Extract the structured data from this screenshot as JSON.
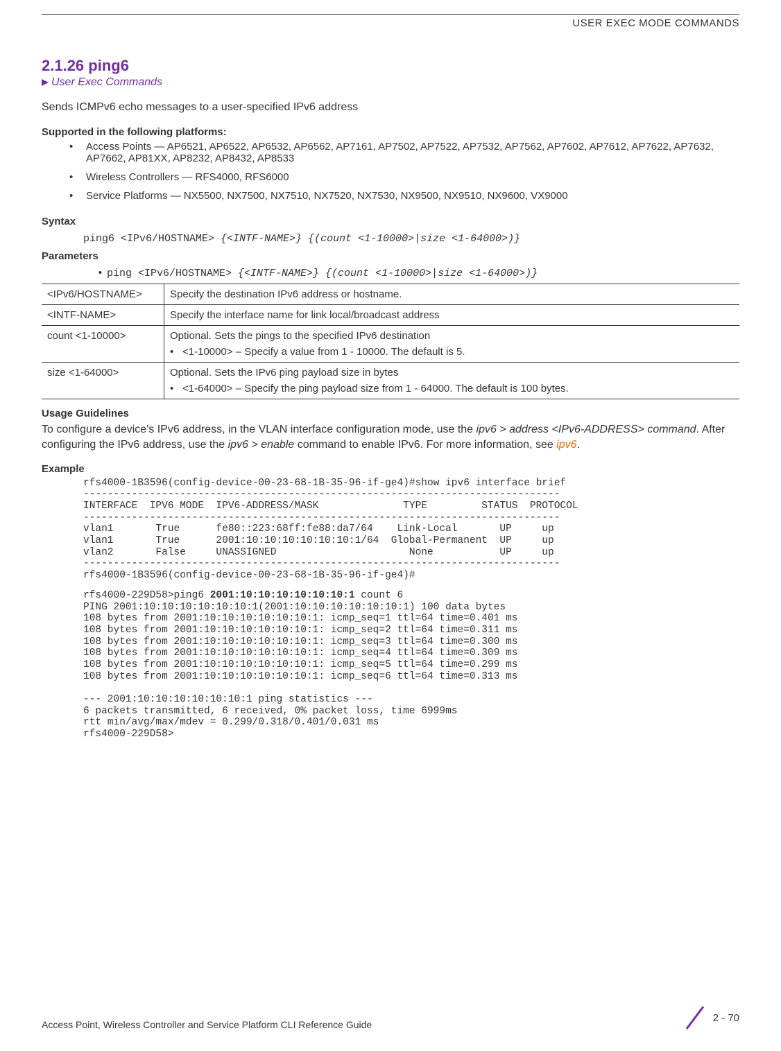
{
  "header": {
    "title": "USER EXEC MODE COMMANDS"
  },
  "section": {
    "number_title": "2.1.26 ping6",
    "breadcrumb": "User Exec Commands",
    "intro": "Sends ICMPv6 echo messages to a user-specified IPv6 address"
  },
  "supported": {
    "heading": "Supported in the following platforms:",
    "items": [
      "Access Points — AP6521, AP6522, AP6532, AP6562, AP7161, AP7502, AP7522, AP7532, AP7562, AP7602, AP7612, AP7622, AP7632, AP7662, AP81XX, AP8232, AP8432, AP8533",
      "Wireless Controllers — RFS4000, RFS6000",
      "Service Platforms — NX5500, NX7500, NX7510, NX7520, NX7530, NX9500, NX9510, NX9600, VX9000"
    ]
  },
  "syntax": {
    "heading": "Syntax",
    "line_plain": "ping6 <IPv6/HOSTNAME> ",
    "line_italic": "{<INTF-NAME>} {(count <1-10000>|size <1-64000>)}"
  },
  "parameters": {
    "heading": "Parameters",
    "line_plain": "ping <IPv6/HOSTNAME> ",
    "line_italic": "{<INTF-NAME>} {(count <1-10000>|size <1-64000>)}",
    "rows": [
      {
        "name": "<IPv6/HOSTNAME>",
        "desc": "Specify the destination IPv6 address or hostname."
      },
      {
        "name": "<INTF-NAME>",
        "desc": "Specify the interface name for link local/broadcast address"
      },
      {
        "name": "count <1-10000>",
        "desc": "Optional. Sets the pings to the specified IPv6 destination",
        "bullet": "<1-10000> – Specify a value from 1 - 10000. The default is 5."
      },
      {
        "name": "size <1-64000>",
        "desc": "Optional. Sets the IPv6 ping payload size in bytes",
        "bullet": "<1-64000> – Specify the ping payload size from 1 - 64000. The default is 100 bytes."
      }
    ]
  },
  "usage": {
    "heading": "Usage Guidelines",
    "text_pre": "To configure a device's IPv6 address, in the VLAN interface configuration mode, use the ",
    "text_cmd1": "ipv6 > address <IPv6-ADDRESS> command",
    "text_mid": ". After configuring the IPv6 address, use the ",
    "text_cmd2": "ipv6 > enable",
    "text_post": " command to enable IPv6. For more information, see ",
    "text_link": "ipv6",
    "text_end": "."
  },
  "example": {
    "heading": "Example",
    "block1": "rfs4000-1B3596(config-device-00-23-68-1B-35-96-if-ge4)#show ipv6 interface brief\n-------------------------------------------------------------------------------\nINTERFACE  IPV6 MODE  IPV6-ADDRESS/MASK              TYPE         STATUS  PROTOCOL\n-------------------------------------------------------------------------------\nvlan1       True      fe80::223:68ff:fe88:da7/64    Link-Local       UP     up\nvlan1       True      2001:10:10:10:10:10:10:1/64  Global-Permanent  UP     up\nvlan2       False     UNASSIGNED                      None           UP     up\n-------------------------------------------------------------------------------\nrfs4000-1B3596(config-device-00-23-68-1B-35-96-if-ge4)#",
    "block2_pre": "rfs4000-229D58>ping6 ",
    "block2_bold": "2001:10:10:10:10:10:10:1",
    "block2_post": " count 6\nPING 2001:10:10:10:10:10:10:1(2001:10:10:10:10:10:10:1) 100 data bytes\n108 bytes from 2001:10:10:10:10:10:10:1: icmp_seq=1 ttl=64 time=0.401 ms\n108 bytes from 2001:10:10:10:10:10:10:1: icmp_seq=2 ttl=64 time=0.311 ms\n108 bytes from 2001:10:10:10:10:10:10:1: icmp_seq=3 ttl=64 time=0.300 ms\n108 bytes from 2001:10:10:10:10:10:10:1: icmp_seq=4 ttl=64 time=0.309 ms\n108 bytes from 2001:10:10:10:10:10:10:1: icmp_seq=5 ttl=64 time=0.299 ms\n108 bytes from 2001:10:10:10:10:10:10:1: icmp_seq=6 ttl=64 time=0.313 ms\n\n--- 2001:10:10:10:10:10:10:1 ping statistics ---\n6 packets transmitted, 6 received, 0% packet loss, time 6999ms\nrtt min/avg/max/mdev = 0.299/0.318/0.401/0.031 ms\nrfs4000-229D58>"
  },
  "footer": {
    "left": "Access Point, Wireless Controller and Service Platform CLI Reference Guide",
    "right": "2 - 70"
  }
}
